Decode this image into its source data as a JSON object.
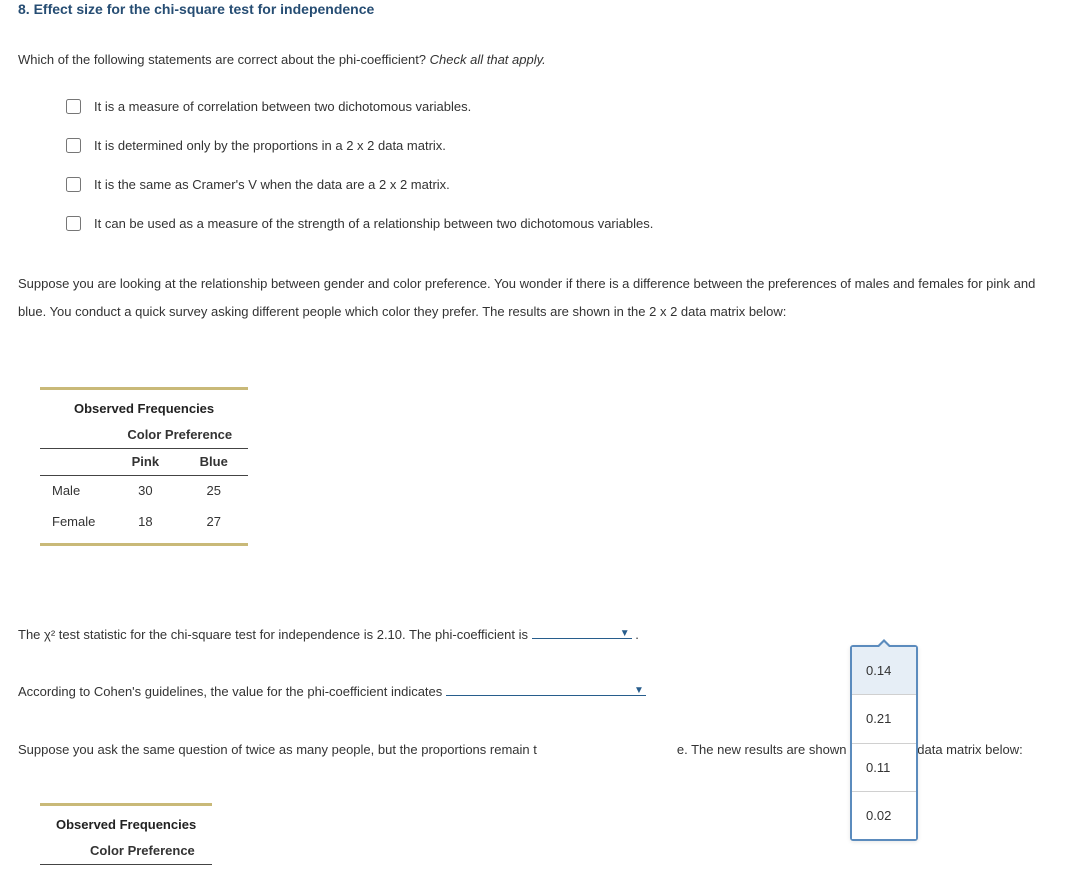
{
  "title": "8. Effect size for the chi-square test for independence",
  "intro": {
    "lead": "Which of the following statements are correct about the phi-coefficient? ",
    "instruction": "Check all that apply."
  },
  "options": {
    "o1": "It is a measure of correlation between two dichotomous variables.",
    "o2": "It is determined only by the proportions in a 2 x 2 data matrix.",
    "o3": "It is the same as Cramer's V when the data are a 2 x 2 matrix.",
    "o4": "It can be used as a measure of the strength of a relationship between two dichotomous variables."
  },
  "scenario": "Suppose you are looking at the relationship between gender and color preference. You wonder if there is a difference between the preferences of males and females for pink and blue. You conduct a quick survey asking different people which color they prefer. The results are shown in the 2 x 2 data matrix below:",
  "table1": {
    "title": "Observed Frequencies",
    "sub": "Color Preference",
    "c1": "Pink",
    "c2": "Blue",
    "r1label": "Male",
    "r1c1": "30",
    "r1c2": "25",
    "r2label": "Female",
    "r2c1": "18",
    "r2c2": "27"
  },
  "sentences": {
    "s1a": "The χ² test statistic for the chi-square test for independence is 2.10. The phi-coefficient is ",
    "s1b": " .",
    "s2a": "According to Cohen's guidelines, the value for the phi-coefficient indicates ",
    "s3a": "Suppose you ask the same question of twice as many people, but the proportions remain t",
    "s3b": "e. The new results are shown in the 2 x 2 data matrix below:"
  },
  "dropdown": {
    "opt1": "0.14",
    "opt2": "0.21",
    "opt3": "0.11",
    "opt4": "0.02"
  },
  "table2": {
    "title": "Observed Frequencies",
    "sub": "Color Preference"
  }
}
